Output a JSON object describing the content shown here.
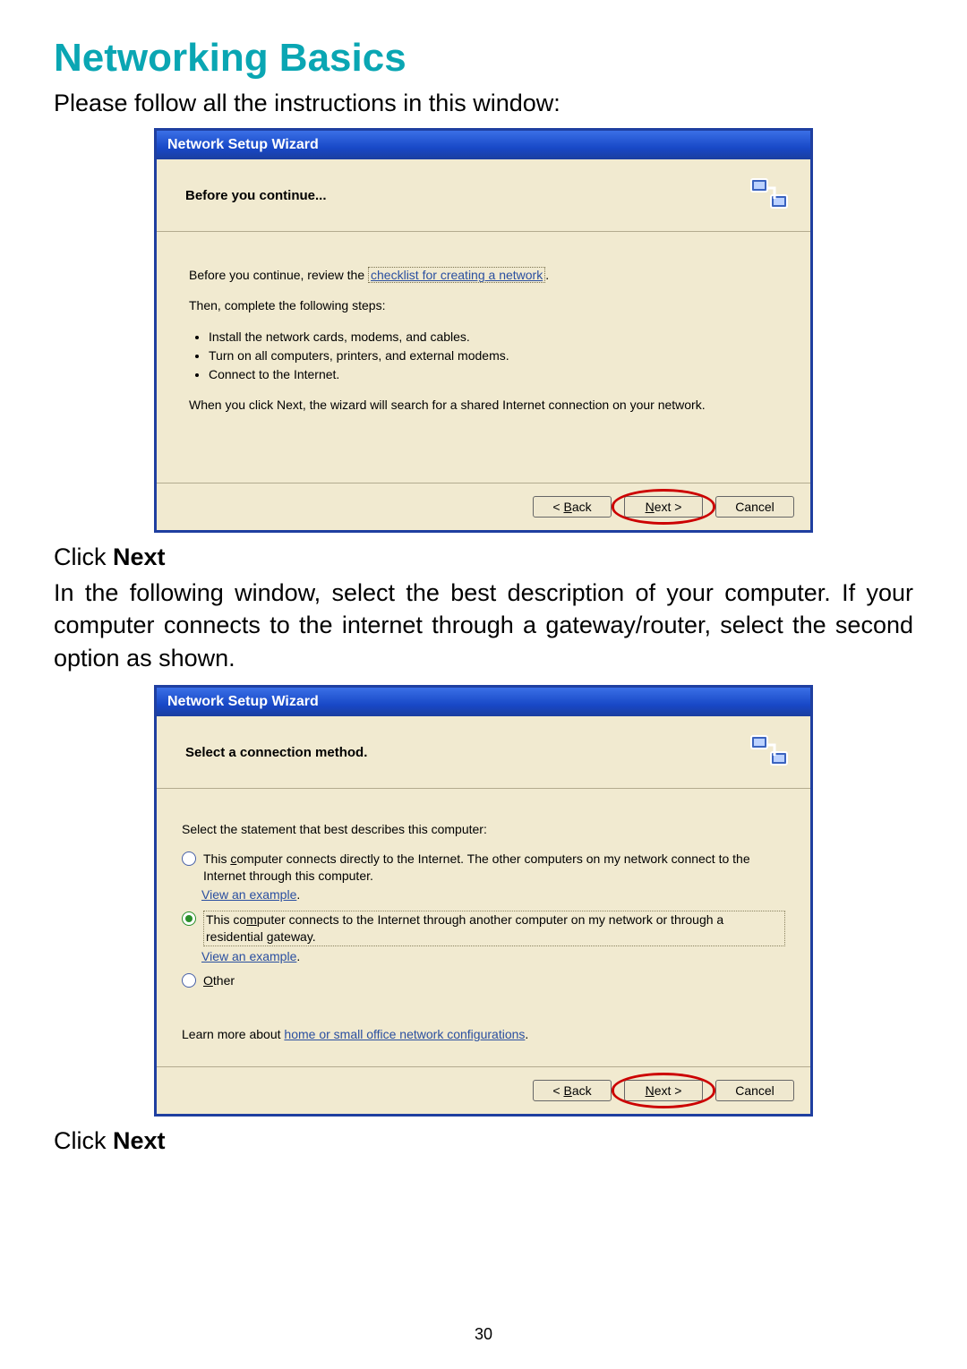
{
  "heading": "Networking Basics",
  "intro_line": "Please follow all the instructions in this window:",
  "click_next_prefix": "Click ",
  "click_next_bold": "Next",
  "description": "In the following window, select the best description of your computer.  If your computer connects to the internet through a gateway/router, select the second option as shown.",
  "page_number": "30",
  "wizard1": {
    "title": "Network Setup Wizard",
    "header": "Before you continue...",
    "line1_prefix": "Before you continue, review the ",
    "line1_link": "checklist for creating a network",
    "line1_suffix": ".",
    "line2": "Then, complete the following steps:",
    "bullets": [
      "Install the network cards, modems, and cables.",
      "Turn on all computers, printers, and external modems.",
      "Connect to the Internet."
    ],
    "line3": "When you click Next, the wizard will search for a shared Internet connection on your network.",
    "buttons": {
      "back_pre": "< ",
      "back_m": "B",
      "back_post": "ack",
      "next_m": "N",
      "next_post": "ext >",
      "cancel": "Cancel"
    }
  },
  "wizard2": {
    "title": "Network Setup Wizard",
    "header": "Select a connection method.",
    "prompt": "Select the statement that best describes this computer:",
    "opt1_pre": "This ",
    "opt1_m": "c",
    "opt1_post": "omputer connects directly to the Internet. The other computers on my network connect to the Internet through this computer.",
    "opt2_pre": "This co",
    "opt2_m": "m",
    "opt2_post": "puter connects to the Internet through another computer on my network or through a residential gateway.",
    "opt3_m": "O",
    "opt3_post": "ther",
    "view_example": "View an example",
    "learn_pre": "Learn more about ",
    "learn_link": "home or small office network configurations",
    "learn_post": ".",
    "selected_index": 1,
    "buttons": {
      "back_pre": "< ",
      "back_m": "B",
      "back_post": "ack",
      "next_m": "N",
      "next_post": "ext >",
      "cancel": "Cancel"
    }
  }
}
